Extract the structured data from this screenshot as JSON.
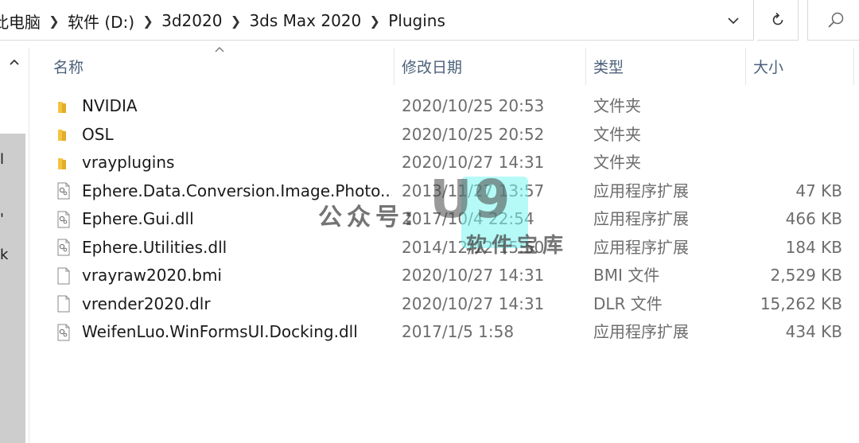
{
  "address": {
    "breadcrumb": [
      "此电脑",
      "软件 (D:)",
      "3d2020",
      "3ds Max 2020",
      "Plugins"
    ]
  },
  "nav_fragments": [
    "l",
    "'",
    "k"
  ],
  "columns": {
    "name": "名称",
    "date": "修改日期",
    "type": "类型",
    "size": "大小"
  },
  "files": [
    {
      "icon": "folder-icon",
      "name": "NVIDIA",
      "date": "2020/10/25 20:53",
      "type": "文件夹",
      "size": ""
    },
    {
      "icon": "folder-icon",
      "name": "OSL",
      "date": "2020/10/25 20:52",
      "type": "文件夹",
      "size": ""
    },
    {
      "icon": "folder-icon",
      "name": "vrayplugins",
      "date": "2020/10/27 14:31",
      "type": "文件夹",
      "size": ""
    },
    {
      "icon": "dll-file-icon",
      "name": "Ephere.Data.Conversion.Image.Photo...",
      "date": "2013/11/27 13:57",
      "type": "应用程序扩展",
      "size": "47 KB"
    },
    {
      "icon": "dll-file-icon",
      "name": "Ephere.Gui.dll",
      "date": "2017/10/4 22:54",
      "type": "应用程序扩展",
      "size": "466 KB"
    },
    {
      "icon": "dll-file-icon",
      "name": "Ephere.Utilities.dll",
      "date": "2014/12/12 15:50",
      "type": "应用程序扩展",
      "size": "184 KB"
    },
    {
      "icon": "file-icon",
      "name": "vrayraw2020.bmi",
      "date": "2020/10/27 14:31",
      "type": "BMI 文件",
      "size": "2,529 KB"
    },
    {
      "icon": "file-icon",
      "name": "vrender2020.dlr",
      "date": "2020/10/27 14:31",
      "type": "DLR 文件",
      "size": "15,262 KB"
    },
    {
      "icon": "dll-file-icon",
      "name": "WeifenLuo.WinFormsUI.Docking.dll",
      "date": "2017/1/5 1:58",
      "type": "应用程序扩展",
      "size": "434 KB"
    }
  ],
  "watermark": {
    "gzh": "公众号:",
    "logo": "U9",
    "site": "软件宝库"
  },
  "colors": {
    "folder": "#f5c342",
    "header_text": "#4c607a",
    "secondary_text": "#6d6d6d",
    "watermark_accent": "#78f5f0"
  }
}
